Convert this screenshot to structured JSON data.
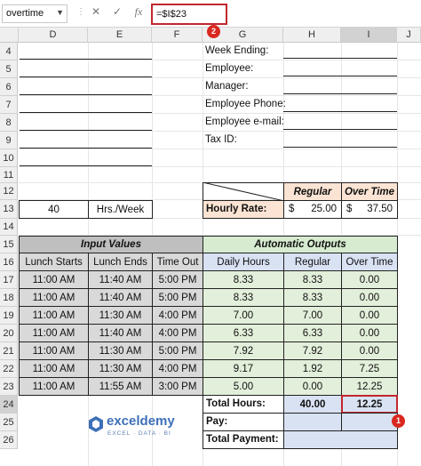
{
  "formula_bar": {
    "name_box": "overtime",
    "cancel_icon": "✕",
    "enter_icon": "✓",
    "fx_label": "fx",
    "formula": "=$I$23",
    "badge": "2"
  },
  "columns": [
    "D",
    "E",
    "F",
    "G",
    "H",
    "I",
    "J"
  ],
  "rows": [
    "4",
    "5",
    "6",
    "7",
    "8",
    "9",
    "10",
    "11",
    "12",
    "13",
    "14",
    "15",
    "16",
    "17",
    "18",
    "19",
    "20",
    "21",
    "22",
    "23",
    "24",
    "25",
    "26"
  ],
  "employee_info": [
    "Week Ending:",
    "Employee:",
    "Manager:",
    "Employee Phone:",
    "Employee e-mail:",
    "Tax ID:"
  ],
  "threshold": {
    "hours": "40",
    "unit": "Hrs./Week"
  },
  "rate_table": {
    "regular_label": "Regular",
    "overtime_label": "Over Time",
    "row_label": "Hourly Rate:",
    "currency": "$",
    "regular_rate": "25.00",
    "overtime_rate": "37.50"
  },
  "input_header": "Input Values",
  "output_header": "Automatic Outputs",
  "headers": [
    "Lunch Starts",
    "Lunch Ends",
    "Time Out",
    "Daily Hours",
    "Regular",
    "Over Time"
  ],
  "entries": [
    [
      "11:00 AM",
      "11:40 AM",
      "5:00 PM",
      "8.33",
      "8.33",
      "0.00"
    ],
    [
      "11:00 AM",
      "11:40 AM",
      "5:00 PM",
      "8.33",
      "8.33",
      "0.00"
    ],
    [
      "11:00 AM",
      "11:30 AM",
      "4:00 PM",
      "7.00",
      "7.00",
      "0.00"
    ],
    [
      "11:00 AM",
      "11:40 AM",
      "4:00 PM",
      "6.33",
      "6.33",
      "0.00"
    ],
    [
      "11:00 AM",
      "11:30 AM",
      "5:00 PM",
      "7.92",
      "7.92",
      "0.00"
    ],
    [
      "11:00 AM",
      "11:30 AM",
      "4:00 PM",
      "9.17",
      "1.92",
      "7.25"
    ],
    [
      "11:00 AM",
      "11:55 AM",
      "3:00 PM",
      "5.00",
      "0.00",
      "12.25"
    ]
  ],
  "totals": {
    "total_hours_label": "Total Hours:",
    "regular_total": "40.00",
    "overtime_total": "12.25",
    "pay_label": "Pay:",
    "total_payment_label": "Total Payment:",
    "badge": "1"
  },
  "watermark": {
    "name": "exceldemy",
    "tagline": "EXCEL · DATA · BI"
  }
}
